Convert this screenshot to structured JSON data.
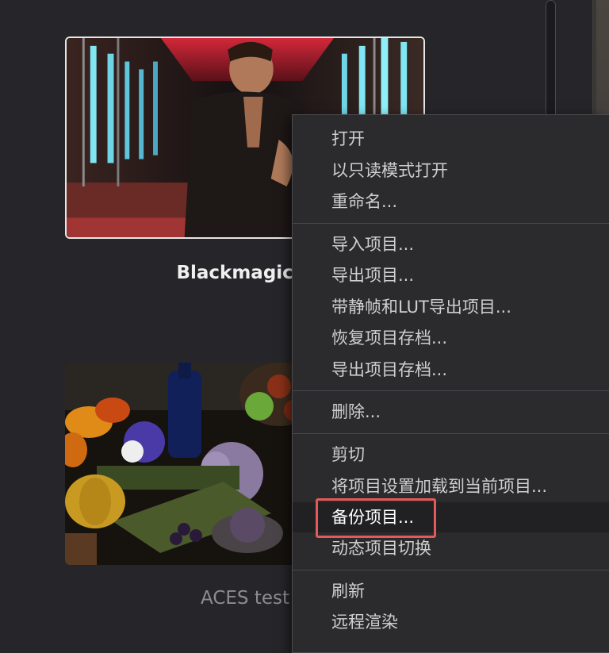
{
  "projects": [
    {
      "name": "Blackmagic R",
      "selected": true
    },
    {
      "name": "ACES test",
      "selected": false
    }
  ],
  "context_menu": {
    "items": [
      {
        "label": "打开"
      },
      {
        "label": "以只读模式打开"
      },
      {
        "label": "重命名..."
      },
      {
        "label": "导入项目..."
      },
      {
        "label": "导出项目..."
      },
      {
        "label": "带静帧和LUT导出项目..."
      },
      {
        "label": "恢复项目存档..."
      },
      {
        "label": "导出项目存档..."
      },
      {
        "label": "删除..."
      },
      {
        "label": "剪切"
      },
      {
        "label": "将项目设置加载到当前项目..."
      },
      {
        "label": "备份项目..."
      },
      {
        "label": "动态项目切换"
      },
      {
        "label": "刷新"
      },
      {
        "label": "远程渲染"
      }
    ],
    "hovered_item": "备份项目...",
    "highlight_color": "#e45a5a"
  }
}
